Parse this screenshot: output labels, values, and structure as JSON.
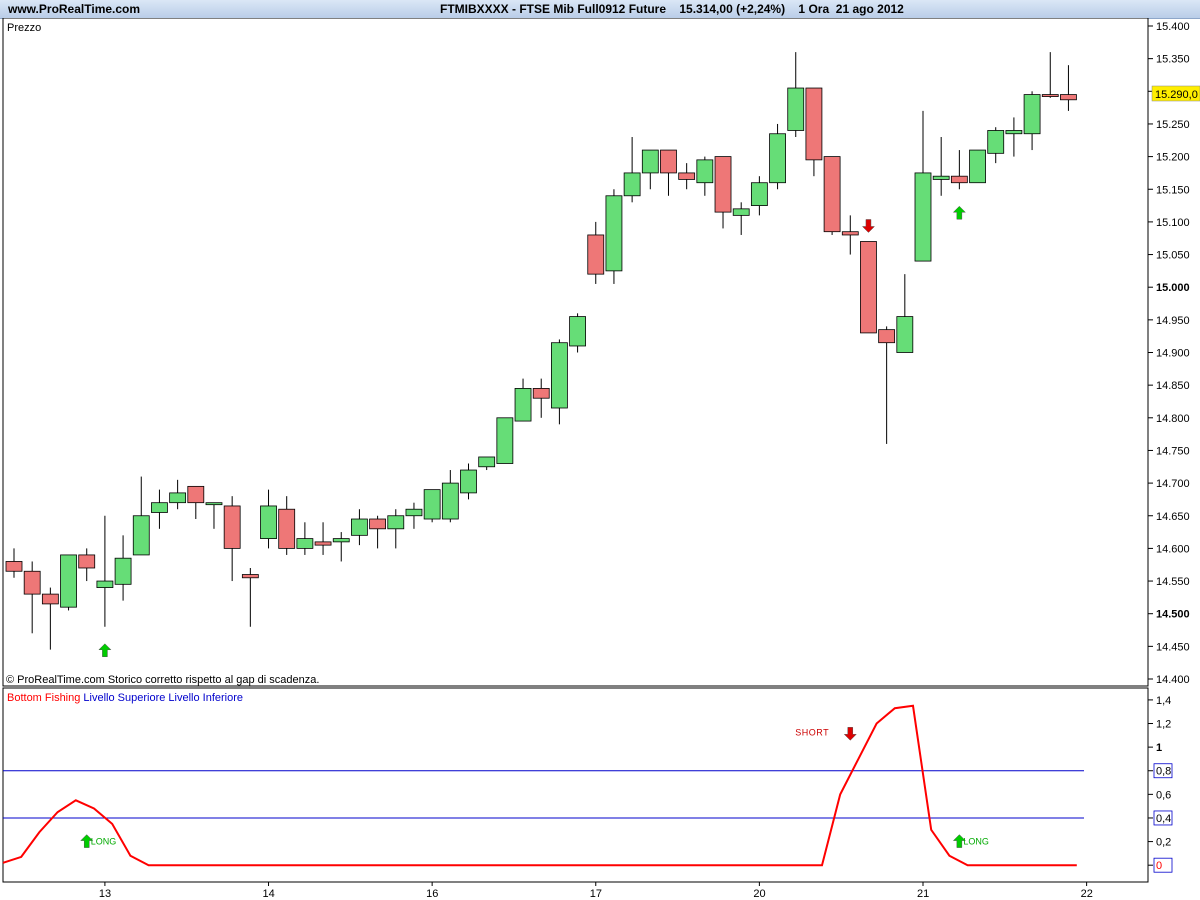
{
  "header": {
    "site": "www.ProRealTime.com",
    "instrument": "FTMIBXXXX - FTSE Mib Full0912 Future    15.314,00 (+2,24%)    1 Ora  21 ago 2012"
  },
  "price_panel": {
    "label": "Prezzo",
    "footer": "© ProRealTime.com  Storico corretto rispetto al gap di scadenza.",
    "current_price_label": "15.290,0"
  },
  "indicator_panel": {
    "legend": [
      {
        "text": "Bottom Fishing",
        "color": "#ff0000"
      },
      {
        "text": " Livello Superiore",
        "color": "#0000cc"
      },
      {
        "text": " Livello Inferiore",
        "color": "#0000cc"
      }
    ],
    "signals": [
      {
        "text": "LONG",
        "index": 4
      },
      {
        "text": "SHORT",
        "index": 46
      },
      {
        "text": "LONG",
        "index": 52
      }
    ]
  },
  "colors": {
    "up": "#66dd77",
    "down": "#ee7777",
    "indicator": "#ff0000",
    "levels": "#0000cc",
    "arrow_up": "#00cc00",
    "arrow_down": "#dd0000",
    "price_tag": "#ffee00"
  },
  "chart_data": [
    {
      "type": "candlestick",
      "title": "FTSE Mib Full0912 Future",
      "ylim": [
        14400,
        15400
      ],
      "y_ticks": [
        14400,
        14450,
        14500,
        14550,
        14600,
        14650,
        14700,
        14750,
        14800,
        14850,
        14900,
        14950,
        15000,
        15050,
        15100,
        15150,
        15200,
        15250,
        15300,
        15350,
        15400
      ],
      "y_tick_labels": [
        "14.400",
        "14.450",
        "14.500",
        "14.550",
        "14.600",
        "14.650",
        "14.700",
        "14.750",
        "14.800",
        "14.850",
        "14.900",
        "14.950",
        "15.000",
        "15.050",
        "15.100",
        "15.150",
        "15.200",
        "15.250",
        "15.300",
        "15.350",
        "15.400"
      ],
      "bold_ticks": [
        14500,
        15000
      ],
      "x_labels": [
        {
          "text": "13",
          "index": 5
        },
        {
          "text": "14",
          "index": 14
        },
        {
          "text": "16",
          "index": 23
        },
        {
          "text": "17",
          "index": 32
        },
        {
          "text": "20",
          "index": 41
        },
        {
          "text": "21",
          "index": 50
        },
        {
          "text": "22",
          "index": 59
        }
      ],
      "candles": [
        [
          14580,
          14600,
          14555,
          14565
        ],
        [
          14565,
          14580,
          14470,
          14530
        ],
        [
          14530,
          14540,
          14445,
          14515
        ],
        [
          14510,
          14590,
          14505,
          14590
        ],
        [
          14590,
          14600,
          14550,
          14570
        ],
        [
          14540,
          14650,
          14480,
          14550
        ],
        [
          14545,
          14620,
          14520,
          14585
        ],
        [
          14590,
          14710,
          14590,
          14650
        ],
        [
          14655,
          14690,
          14630,
          14670
        ],
        [
          14670,
          14705,
          14660,
          14685
        ],
        [
          14695,
          14695,
          14645,
          14670
        ],
        [
          14670,
          14670,
          14630,
          14670
        ],
        [
          14665,
          14680,
          14550,
          14600
        ],
        [
          14560,
          14570,
          14480,
          14555
        ],
        [
          14615,
          14690,
          14600,
          14665
        ],
        [
          14660,
          14680,
          14590,
          14600
        ],
        [
          14600,
          14640,
          14590,
          14615
        ],
        [
          14610,
          14640,
          14590,
          14605
        ],
        [
          14610,
          14625,
          14580,
          14615
        ],
        [
          14620,
          14660,
          14605,
          14645
        ],
        [
          14645,
          14650,
          14600,
          14630
        ],
        [
          14630,
          14660,
          14600,
          14650
        ],
        [
          14650,
          14670,
          14630,
          14660
        ],
        [
          14645,
          14690,
          14640,
          14690
        ],
        [
          14645,
          14720,
          14640,
          14700
        ],
        [
          14685,
          14730,
          14675,
          14720
        ],
        [
          14725,
          14735,
          14720,
          14740
        ],
        [
          14730,
          14800,
          14730,
          14800
        ],
        [
          14795,
          14860,
          14795,
          14845
        ],
        [
          14845,
          14860,
          14800,
          14830
        ],
        [
          14815,
          14920,
          14790,
          14915
        ],
        [
          14910,
          14960,
          14900,
          14955
        ],
        [
          15080,
          15100,
          15005,
          15020
        ],
        [
          15025,
          15150,
          15005,
          15140
        ],
        [
          15140,
          15230,
          15130,
          15175
        ],
        [
          15175,
          15210,
          15150,
          15210
        ],
        [
          15210,
          15210,
          15140,
          15175
        ],
        [
          15175,
          15190,
          15150,
          15165
        ],
        [
          15160,
          15200,
          15140,
          15195
        ],
        [
          15200,
          15200,
          15090,
          15115
        ],
        [
          15110,
          15130,
          15080,
          15120
        ],
        [
          15125,
          15170,
          15110,
          15160
        ],
        [
          15160,
          15250,
          15150,
          15235
        ],
        [
          15240,
          15360,
          15230,
          15305
        ],
        [
          15305,
          15305,
          15170,
          15195
        ],
        [
          15200,
          15200,
          15080,
          15085
        ],
        [
          15085,
          15110,
          15050,
          15080
        ],
        [
          15070,
          15070,
          14930,
          14930
        ],
        [
          14935,
          14940,
          14760,
          14915
        ],
        [
          14900,
          15020,
          14900,
          14955
        ],
        [
          15040,
          15270,
          15040,
          15175
        ],
        [
          15165,
          15230,
          15140,
          15170
        ],
        [
          15170,
          15210,
          15150,
          15160
        ],
        [
          15160,
          15210,
          15160,
          15210
        ],
        [
          15205,
          15245,
          15190,
          15240
        ],
        [
          15235,
          15260,
          15200,
          15240
        ],
        [
          15235,
          15300,
          15210,
          15295
        ],
        [
          15295,
          15360,
          15290,
          15292
        ],
        [
          15295,
          15340,
          15270,
          15287
        ]
      ],
      "signals": [
        {
          "type": "long",
          "index": 5
        },
        {
          "type": "short",
          "index": 47
        },
        {
          "type": "long",
          "index": 52
        }
      ]
    },
    {
      "type": "line",
      "series": [
        {
          "name": "Bottom Fishing",
          "values": [
            0.02,
            0.07,
            0.28,
            0.45,
            0.55,
            0.48,
            0.35,
            0.08,
            0.0,
            0.0,
            0.0,
            0.0,
            0.0,
            0.0,
            0.0,
            0.0,
            0.0,
            0.0,
            0.0,
            0.0,
            0.0,
            0.0,
            0.0,
            0.0,
            0.0,
            0.0,
            0.0,
            0.0,
            0.0,
            0.0,
            0.0,
            0.0,
            0.0,
            0.0,
            0.0,
            0.0,
            0.0,
            0.0,
            0.0,
            0.0,
            0.0,
            0.0,
            0.0,
            0.0,
            0.0,
            0.0,
            0.6,
            0.9,
            1.2,
            1.33,
            1.35,
            0.3,
            0.08,
            0.0,
            0.0,
            0.0,
            0.0,
            0.0,
            0.0,
            0.0
          ]
        },
        {
          "name": "Livello Superiore",
          "values": [
            0.8
          ]
        },
        {
          "name": "Livello Inferiore",
          "values": [
            0.4
          ]
        }
      ],
      "ylim": [
        -0.1,
        1.45
      ],
      "y_ticks": [
        0,
        0.2,
        0.4,
        0.6,
        0.8,
        1,
        1.2,
        1.4
      ],
      "y_tick_labels": [
        "0",
        "0,2",
        "0,4",
        "0,6",
        "0,8",
        "1",
        "1,2",
        "1,4"
      ],
      "boxed_ticks": [
        0,
        0.4,
        0.8
      ]
    }
  ]
}
